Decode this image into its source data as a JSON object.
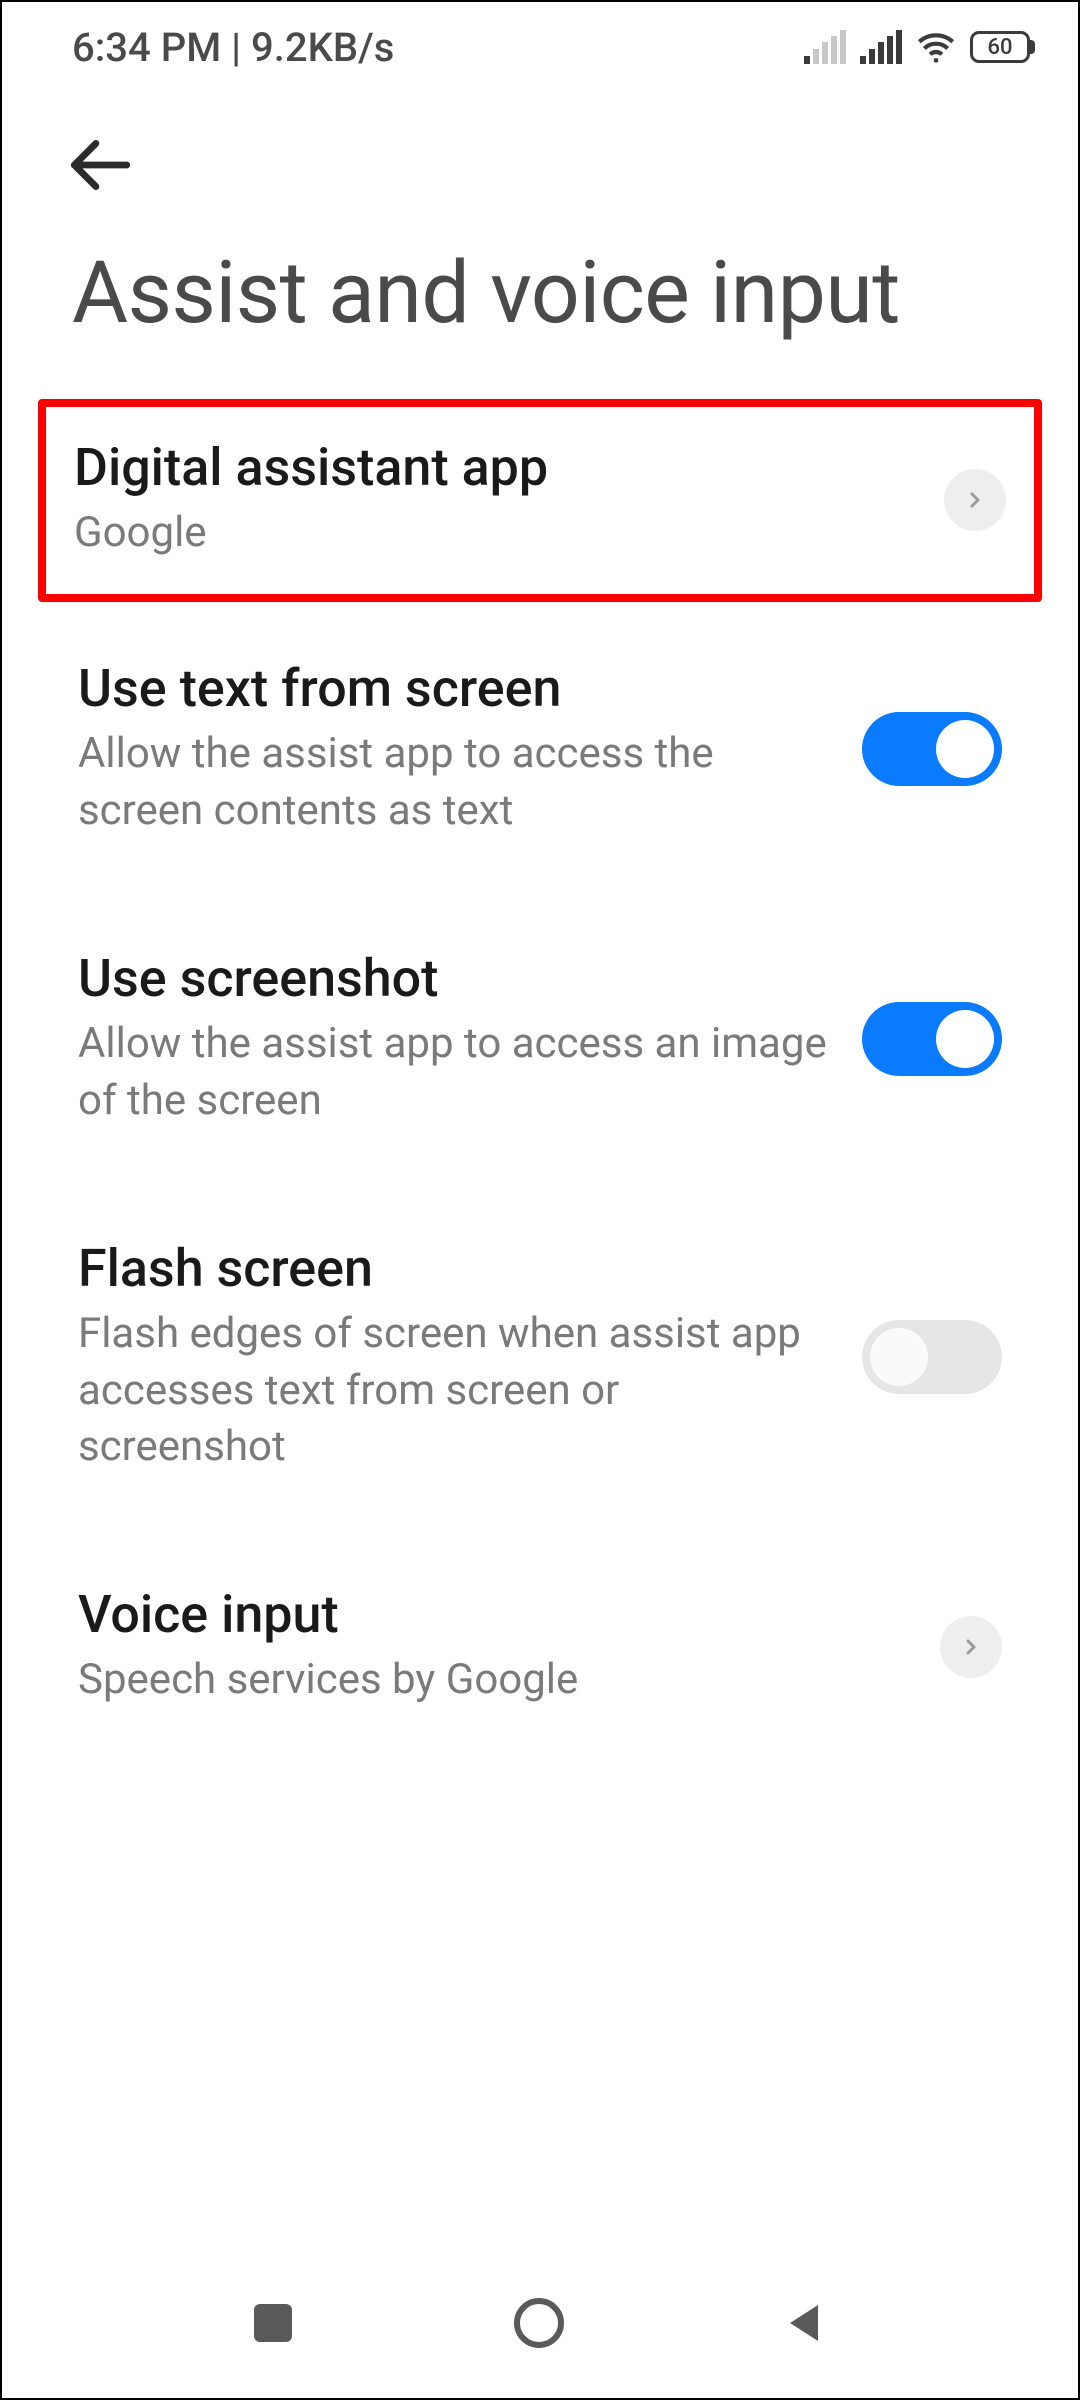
{
  "status_bar": {
    "time": "6:34 PM",
    "net_speed": "9.2KB/s",
    "battery_pct": "60"
  },
  "page": {
    "title": "Assist and voice input"
  },
  "items": {
    "digital_assistant": {
      "title": "Digital assistant app",
      "subtitle": "Google"
    },
    "use_text": {
      "title": "Use text from screen",
      "subtitle": "Allow the assist app to access the screen contents as text",
      "enabled": true
    },
    "use_screenshot": {
      "title": "Use screenshot",
      "subtitle": "Allow the assist app to access an image of the screen",
      "enabled": true
    },
    "flash_screen": {
      "title": "Flash screen",
      "subtitle": "Flash edges of screen when assist app accesses text from screen or screenshot",
      "enabled": false
    },
    "voice_input": {
      "title": "Voice input",
      "subtitle": "Speech services by Google"
    }
  }
}
